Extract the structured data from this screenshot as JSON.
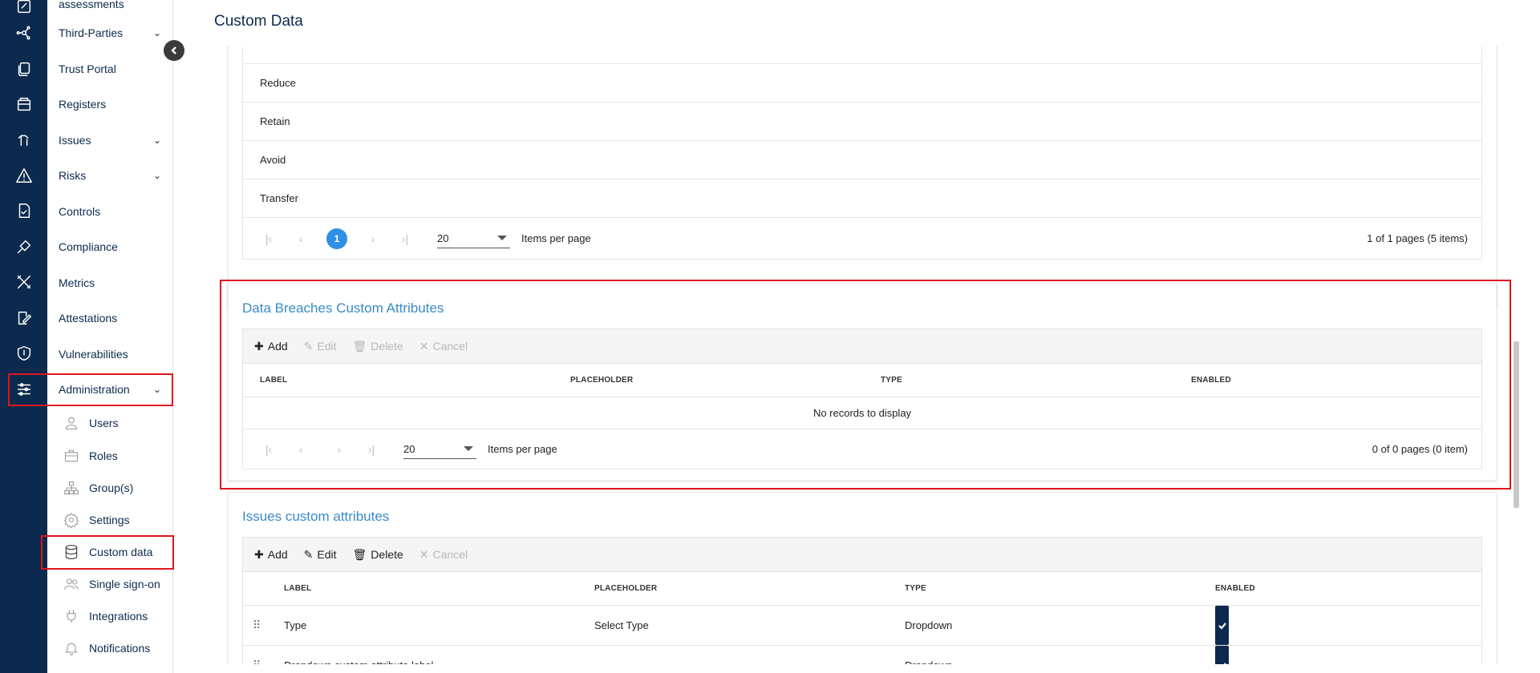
{
  "page": {
    "title": "Custom Data"
  },
  "nav": {
    "items": [
      {
        "label": "assessments",
        "chevron": false
      },
      {
        "label": "Third-Parties",
        "chevron": true
      },
      {
        "label": "Trust Portal",
        "chevron": false
      },
      {
        "label": "Registers",
        "chevron": false
      },
      {
        "label": "Issues",
        "chevron": true
      },
      {
        "label": "Risks",
        "chevron": true
      },
      {
        "label": "Controls",
        "chevron": false
      },
      {
        "label": "Compliance",
        "chevron": false
      },
      {
        "label": "Metrics",
        "chevron": false
      },
      {
        "label": "Attestations",
        "chevron": false
      },
      {
        "label": "Vulnerabilities",
        "chevron": false
      },
      {
        "label": "Administration",
        "chevron": true
      }
    ],
    "chevron_glyph": "⌄",
    "admin_sub": [
      {
        "label": "Users",
        "icon": "user-icon"
      },
      {
        "label": "Roles",
        "icon": "briefcase-icon"
      },
      {
        "label": "Group(s)",
        "icon": "hierarchy-icon"
      },
      {
        "label": "Settings",
        "icon": "gear-icon"
      },
      {
        "label": "Custom data",
        "icon": "database-icon"
      },
      {
        "label": "Single sign-on",
        "icon": "users-icon"
      },
      {
        "label": "Integrations",
        "icon": "plug-icon"
      },
      {
        "label": "Notifications",
        "icon": "bell-icon"
      }
    ]
  },
  "risk_responses": {
    "rows": [
      "Reduce",
      "Retain",
      "Avoid",
      "Transfer"
    ],
    "pager": {
      "current_page": "1",
      "page_size": "20",
      "items_per_page_label": "Items per page",
      "info": "1 of 1 pages (5 items)"
    }
  },
  "data_breaches": {
    "title": "Data Breaches Custom Attributes",
    "toolbar": {
      "add": "Add",
      "edit": "Edit",
      "delete": "Delete",
      "cancel": "Cancel"
    },
    "columns": [
      "LABEL",
      "PLACEHOLDER",
      "TYPE",
      "ENABLED"
    ],
    "empty": "No records to display",
    "pager": {
      "page_size": "20",
      "items_per_page_label": "Items per page",
      "info": "0 of 0 pages (0 item)"
    }
  },
  "issues": {
    "title": "Issues custom attributes",
    "toolbar": {
      "add": "Add",
      "edit": "Edit",
      "delete": "Delete",
      "cancel": "Cancel"
    },
    "columns": [
      "LABEL",
      "PLACEHOLDER",
      "TYPE",
      "ENABLED"
    ],
    "rows": [
      {
        "label": "Type",
        "placeholder": "Select Type",
        "type": "Dropdown",
        "enabled": true
      },
      {
        "label": "Dropdown custom attribute label",
        "placeholder": "",
        "type": "Dropdown",
        "enabled": true
      }
    ]
  },
  "glyphs": {
    "first": "|‹",
    "prev": "‹",
    "next": "›",
    "last": "›|",
    "add": "✚",
    "edit": "✎",
    "delete": "🗑",
    "cancel": "✕",
    "drag": "⠿"
  },
  "colors": {
    "rail": "#0c2a4d",
    "accent_title": "#3a8bc8",
    "highlight": "#e0141e",
    "page_active": "#2f8fe5"
  }
}
